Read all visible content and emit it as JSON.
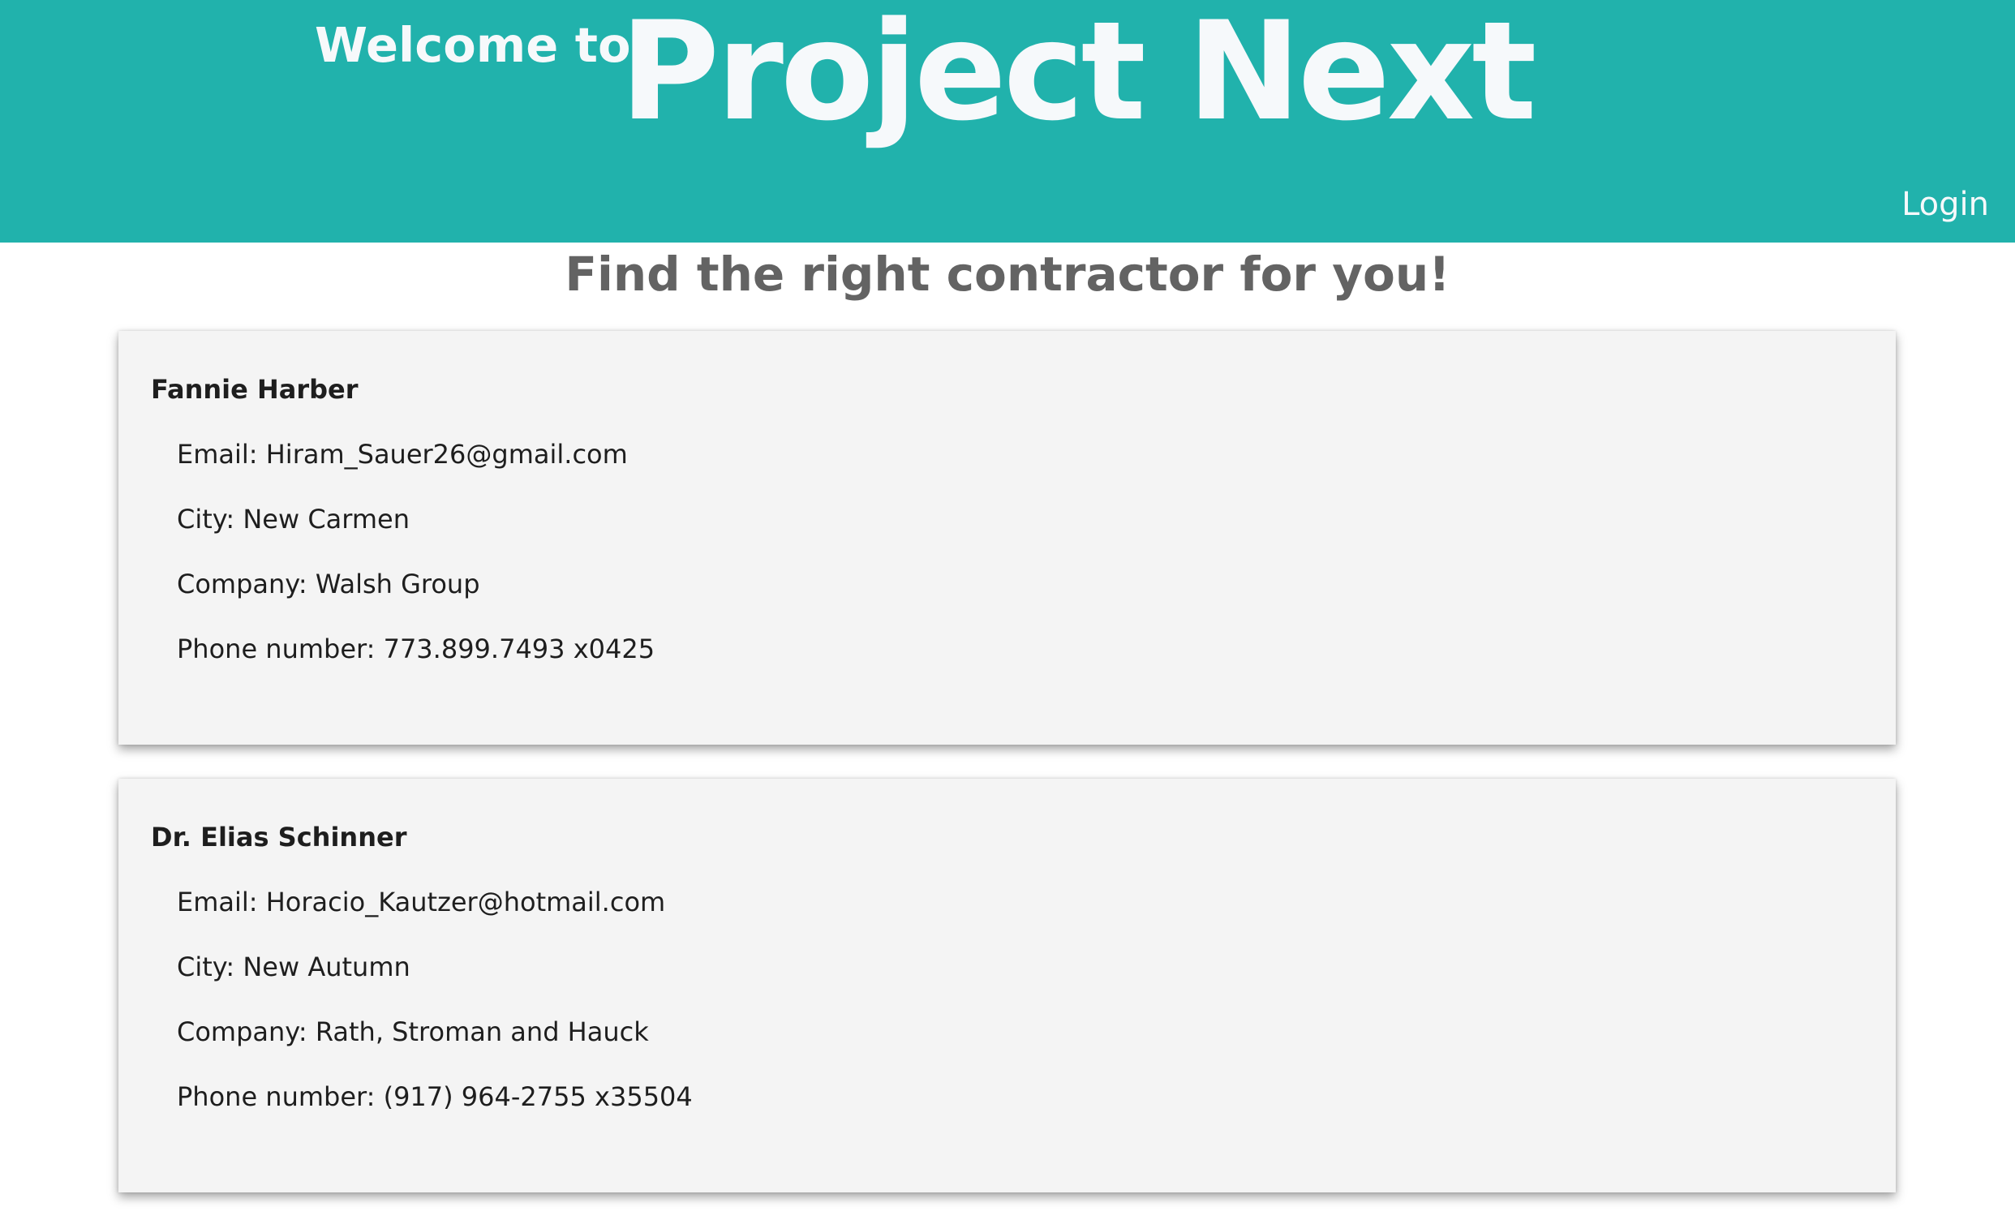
{
  "header": {
    "welcome_prefix": "Welcome to",
    "brand": "Project Next",
    "login_label": "Login"
  },
  "main": {
    "heading": "Find the right contractor for you!",
    "contractors": [
      {
        "name": "Fannie Harber",
        "email": "Email: Hiram_Sauer26@gmail.com",
        "city": "City: New Carmen",
        "company": "Company: Walsh Group",
        "phone": "Phone number: 773.899.7493 x0425"
      },
      {
        "name": "Dr. Elias Schinner",
        "email": "Email: Horacio_Kautzer@hotmail.com",
        "city": "City: New Autumn",
        "company": "Company: Rath, Stroman and Hauck",
        "phone": "Phone number: (917) 964-2755 x35504"
      }
    ]
  },
  "colors": {
    "header_background": "#21b2ac",
    "header_text": "#f6f9fb",
    "heading_text": "#636363",
    "card_background": "#f4f4f4",
    "body_text": "#1e1e1e"
  }
}
